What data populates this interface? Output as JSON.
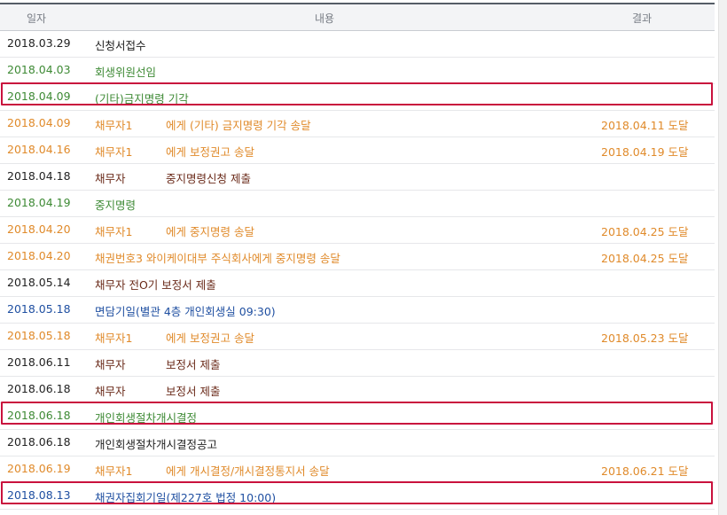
{
  "headers": {
    "date": "일자",
    "content": "내용",
    "result": "결과"
  },
  "colors": {
    "highlight": "#c9123d",
    "green": "#3e8a35",
    "orange": "#e08a2a",
    "brown": "#6a2a19",
    "blue": "#1f4fa1"
  },
  "rows": [
    {
      "date": "2018.03.29",
      "a": "신청서접수",
      "b": "",
      "result": ""
    },
    {
      "date": "2018.04.03",
      "a": "회생위원선임",
      "b": "",
      "result": ""
    },
    {
      "date": "2018.04.09",
      "a": "(기타)금지명령 기각",
      "b": "",
      "result": ""
    },
    {
      "date": "2018.04.09",
      "a": "채무자1",
      "b": "에게 (기타) 금지명령 기각 송달",
      "result": "2018.04.11 도달"
    },
    {
      "date": "2018.04.16",
      "a": "채무자1",
      "b": "에게 보정권고 송달",
      "result": "2018.04.19 도달"
    },
    {
      "date": "2018.04.18",
      "a": "채무자",
      "b": "중지명령신청 제출",
      "result": ""
    },
    {
      "date": "2018.04.19",
      "a": "중지명령",
      "b": "",
      "result": ""
    },
    {
      "date": "2018.04.20",
      "a": "채무자1",
      "b": "에게 중지명령 송달",
      "result": "2018.04.25 도달"
    },
    {
      "date": "2018.04.20",
      "a": "채권번호3 와이케이대부 주식회사에게 중지명령 송달",
      "b": "",
      "result": "2018.04.25 도달"
    },
    {
      "date": "2018.05.14",
      "a": "채무자 전O기 보정서 제출",
      "b": "",
      "result": ""
    },
    {
      "date": "2018.05.18",
      "a": "면담기일(별관 4층 개인회생실 09:30)",
      "b": "",
      "result": ""
    },
    {
      "date": "2018.05.18",
      "a": "채무자1",
      "b": "에게 보정권고 송달",
      "result": "2018.05.23 도달"
    },
    {
      "date": "2018.06.11",
      "a": "채무자",
      "b": "보정서 제출",
      "result": ""
    },
    {
      "date": "2018.06.18",
      "a": "채무자",
      "b": "보정서 제출",
      "result": ""
    },
    {
      "date": "2018.06.18",
      "a": "개인회생절차개시결정",
      "b": "",
      "result": ""
    },
    {
      "date": "2018.06.18",
      "a": "개인회생절차개시결정공고",
      "b": "",
      "result": ""
    },
    {
      "date": "2018.06.19",
      "a": "채무자1",
      "b": "에게 개시결정/개시결정통지서 송달",
      "result": "2018.06.21 도달"
    },
    {
      "date": "2018.08.13",
      "a": "채권자집회기일(제227호 법정 10:00)",
      "b": "",
      "result": ""
    }
  ]
}
